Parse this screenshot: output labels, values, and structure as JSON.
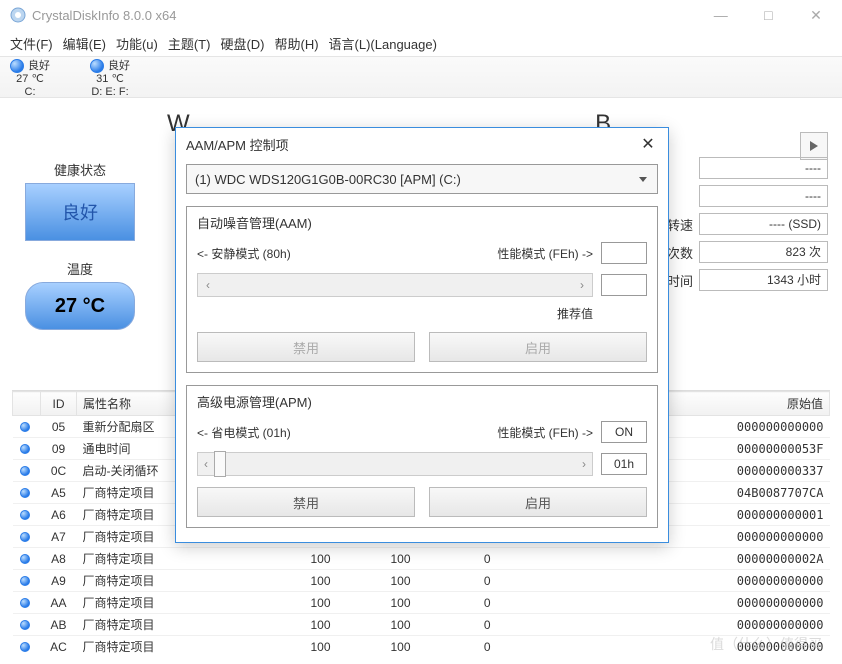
{
  "window": {
    "title": "CrystalDiskInfo 8.0.0 x64"
  },
  "menu": [
    "文件(F)",
    "编辑(E)",
    "功能(u)",
    "主题(T)",
    "硬盘(D)",
    "帮助(H)",
    "语言(L)(Language)"
  ],
  "drives": [
    {
      "status": "良好",
      "temp": "27 ℃",
      "letters": "C:"
    },
    {
      "status": "良好",
      "temp": "31 ℃",
      "letters": "D: E: F:"
    }
  ],
  "disk": {
    "title_prefix": "W",
    "title_suffix": "B"
  },
  "left": {
    "health_label": "健康状态",
    "health_value": "良好",
    "temp_label": "温度",
    "temp_value": "27 °C"
  },
  "stats": {
    "rows": [
      {
        "k": "",
        "v": "----"
      },
      {
        "k": "",
        "v": "----"
      },
      {
        "k": "转速",
        "v": "---- (SSD)"
      },
      {
        "k": "次数",
        "v": "823 次"
      },
      {
        "k": "时间",
        "v": "1343 小时"
      }
    ]
  },
  "dialog": {
    "title": "AAM/APM 控制项",
    "select_text": "(1) WDC WDS120G1G0B-00RC30 [APM] (C:)",
    "aam": {
      "section_title": "自动噪音管理(AAM)",
      "quiet": "<- 安静模式 (80h)",
      "perf": "性能模式 (FEh) ->",
      "rec_label": "推荐值",
      "val": "",
      "rec_val": "",
      "disable": "禁用",
      "enable": "启用"
    },
    "apm": {
      "section_title": "高级电源管理(APM)",
      "save": "<- 省电模式 (01h)",
      "perf": "性能模式 (FEh) ->",
      "on": "ON",
      "val": "01h",
      "disable": "禁用",
      "enable": "启用"
    }
  },
  "columns": {
    "c0": "",
    "c1": "ID",
    "c2": "属性名称",
    "c3": "",
    "c4": "",
    "c5": "",
    "c6": "原始值"
  },
  "rows": [
    {
      "id": "05",
      "name": "重新分配扇区",
      "c3": "",
      "c4": "",
      "c5": "",
      "raw": "000000000000"
    },
    {
      "id": "09",
      "name": "通电时间",
      "c3": "",
      "c4": "",
      "c5": "",
      "raw": "00000000053F"
    },
    {
      "id": "0C",
      "name": "启动-关闭循环",
      "c3": "",
      "c4": "",
      "c5": "",
      "raw": "000000000337"
    },
    {
      "id": "A5",
      "name": "厂商特定项目",
      "c3": "",
      "c4": "",
      "c5": "",
      "raw": "04B0087707CA"
    },
    {
      "id": "A6",
      "name": "厂商特定项目",
      "c3": "",
      "c4": "",
      "c5": "",
      "raw": "000000000001"
    },
    {
      "id": "A7",
      "name": "厂商特定项目",
      "c3": "",
      "c4": "",
      "c5": "",
      "raw": "000000000000"
    },
    {
      "id": "A8",
      "name": "厂商特定项目",
      "c3": "100",
      "c4": "100",
      "c5": "0",
      "raw": "00000000002A"
    },
    {
      "id": "A9",
      "name": "厂商特定项目",
      "c3": "100",
      "c4": "100",
      "c5": "0",
      "raw": "000000000000"
    },
    {
      "id": "AA",
      "name": "厂商特定项目",
      "c3": "100",
      "c4": "100",
      "c5": "0",
      "raw": "000000000000"
    },
    {
      "id": "AB",
      "name": "厂商特定项目",
      "c3": "100",
      "c4": "100",
      "c5": "0",
      "raw": "000000000000"
    },
    {
      "id": "AC",
      "name": "厂商特定项目",
      "c3": "100",
      "c4": "100",
      "c5": "0",
      "raw": "000000000000"
    }
  ],
  "watermark": "值（什么）值得买"
}
